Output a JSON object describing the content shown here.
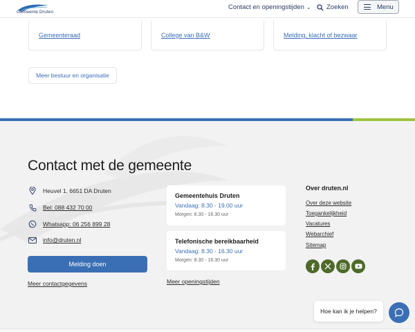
{
  "header": {
    "logo_text": "Gemeente Druten",
    "contact_label": "Contact en openingstijden",
    "search_label": "Zoeken",
    "menu_label": "Menu"
  },
  "cards": [
    {
      "label": "Gemeenteraad"
    },
    {
      "label": "College van B&W"
    },
    {
      "label": "Melding, klacht of bezwaar"
    }
  ],
  "more_button": "Meer bestuur en organisatie",
  "footer": {
    "title": "Contact met de gemeente",
    "address": "Heuvel 1, 6651 DA Druten",
    "phone": "Bel: 088 432 70 00",
    "whatsapp": "Whatsapp: 06 256 899 28",
    "email": "info@druten.nl",
    "melding_button": "Melding doen",
    "more_contact": "Meer contactgegevens",
    "hours": [
      {
        "title": "Gemeentehuis Druten",
        "today": "Vandaag: 8.30 - 19.00 uur",
        "tomorrow": "Morgen: 8.30 - 16.30 uur"
      },
      {
        "title": "Telefonische bereikbaarheid",
        "today": "Vandaag: 8.30 - 16.30 uur",
        "tomorrow": "Morgen: 8.30 - 16.30 uur"
      }
    ],
    "more_hours": "Meer openingstijden",
    "about_title": "Over druten.nl",
    "about_links": [
      "Over deze website",
      "Toegankelijkheid",
      "Vacatures",
      "Webarchief",
      "Sitemap"
    ],
    "social": [
      "facebook-icon",
      "x-icon",
      "instagram-icon",
      "youtube-icon"
    ],
    "help_text": "Hoe kan ik je helpen?"
  },
  "colors": {
    "primary_blue": "#3a6fb5",
    "accent_green": "#9bc43f",
    "social_green": "#4e6a2a",
    "footer_bg": "#f2f2f2"
  }
}
